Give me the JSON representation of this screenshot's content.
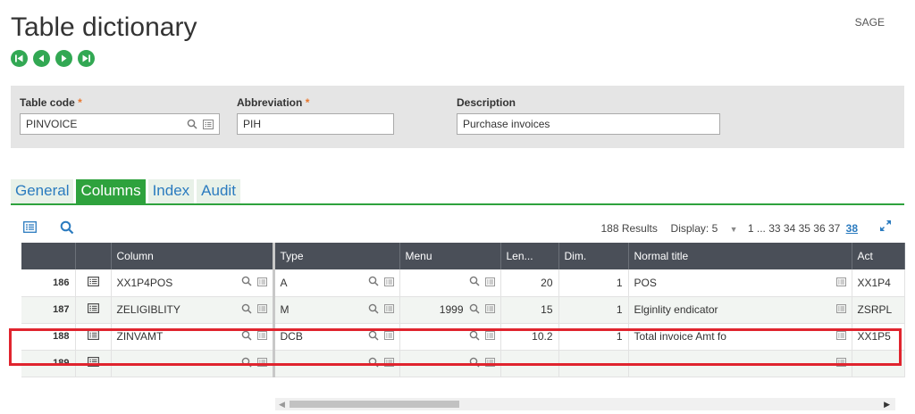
{
  "page": {
    "title": "Table dictionary",
    "user": "SAGE"
  },
  "nav": {
    "icons": [
      "first-record-icon",
      "previous-record-icon",
      "next-record-icon",
      "last-record-icon"
    ]
  },
  "header": {
    "table_code": {
      "label": "Table code",
      "value": "PINVOICE",
      "required": true
    },
    "abbreviation": {
      "label": "Abbreviation",
      "value": "PIH",
      "required": true
    },
    "description": {
      "label": "Description",
      "value": "Purchase invoices"
    },
    "required_mark": "*"
  },
  "tabs": [
    {
      "label": "General",
      "active": false
    },
    {
      "label": "Columns",
      "active": true
    },
    {
      "label": "Index",
      "active": false
    },
    {
      "label": "Audit",
      "active": false
    }
  ],
  "grid": {
    "results": "188 Results",
    "display_label": "Display:",
    "display_value": "5",
    "pagination": "1 ... 33 34 35 36 37",
    "current_page": "38",
    "columns": [
      "Column",
      "Type",
      "Menu",
      "Len...",
      "Dim.",
      "Normal title",
      "Act"
    ],
    "rows": [
      {
        "num": "186",
        "column": "XX1P4POS",
        "type": "A",
        "menu": "",
        "len": "20",
        "dim": "1",
        "title": "POS",
        "act": "XX1P4"
      },
      {
        "num": "187",
        "column": "ZELIGIBLITY",
        "type": "M",
        "menu": "1999",
        "len": "15",
        "dim": "1",
        "title": "Elginlity endicator",
        "act": "ZSRPL"
      },
      {
        "num": "188",
        "column": "ZINVAMT",
        "type": "DCB",
        "menu": "",
        "len": "10.2",
        "dim": "1",
        "title": "Total invoice Amt fo",
        "act": "XX1P5"
      },
      {
        "num": "189",
        "column": "",
        "type": "",
        "menu": "",
        "len": "",
        "dim": "",
        "title": "",
        "act": ""
      }
    ],
    "highlighted_row": "188"
  },
  "colors": {
    "accent": "#2ea23d",
    "link": "#2b7bbf",
    "header_bg": "#4a4f58",
    "highlight": "#e0242e",
    "required": "#e8772e"
  }
}
